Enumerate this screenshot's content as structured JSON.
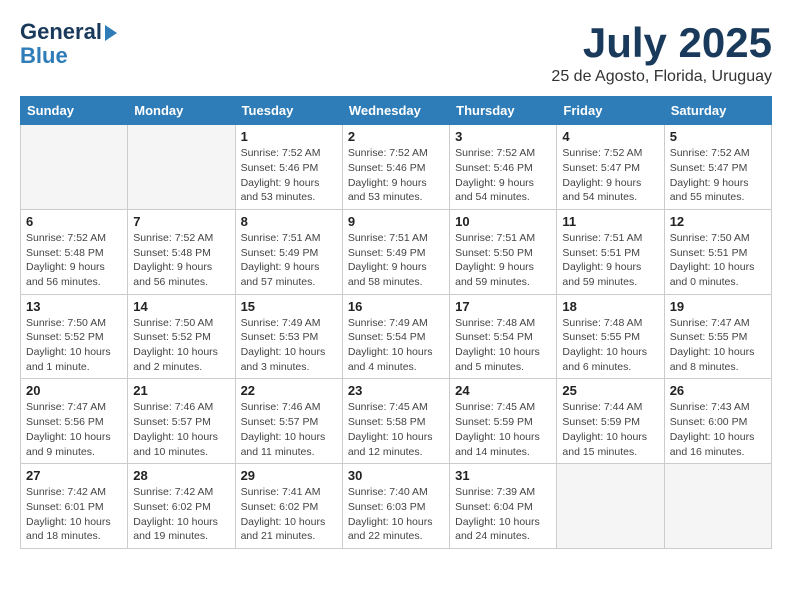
{
  "logo": {
    "line1": "General",
    "line2": "Blue"
  },
  "title": "July 2025",
  "location": "25 de Agosto, Florida, Uruguay",
  "days_of_week": [
    "Sunday",
    "Monday",
    "Tuesday",
    "Wednesday",
    "Thursday",
    "Friday",
    "Saturday"
  ],
  "weeks": [
    [
      {
        "day": "",
        "info": ""
      },
      {
        "day": "",
        "info": ""
      },
      {
        "day": "1",
        "info": "Sunrise: 7:52 AM\nSunset: 5:46 PM\nDaylight: 9 hours\nand 53 minutes."
      },
      {
        "day": "2",
        "info": "Sunrise: 7:52 AM\nSunset: 5:46 PM\nDaylight: 9 hours\nand 53 minutes."
      },
      {
        "day": "3",
        "info": "Sunrise: 7:52 AM\nSunset: 5:46 PM\nDaylight: 9 hours\nand 54 minutes."
      },
      {
        "day": "4",
        "info": "Sunrise: 7:52 AM\nSunset: 5:47 PM\nDaylight: 9 hours\nand 54 minutes."
      },
      {
        "day": "5",
        "info": "Sunrise: 7:52 AM\nSunset: 5:47 PM\nDaylight: 9 hours\nand 55 minutes."
      }
    ],
    [
      {
        "day": "6",
        "info": "Sunrise: 7:52 AM\nSunset: 5:48 PM\nDaylight: 9 hours\nand 56 minutes."
      },
      {
        "day": "7",
        "info": "Sunrise: 7:52 AM\nSunset: 5:48 PM\nDaylight: 9 hours\nand 56 minutes."
      },
      {
        "day": "8",
        "info": "Sunrise: 7:51 AM\nSunset: 5:49 PM\nDaylight: 9 hours\nand 57 minutes."
      },
      {
        "day": "9",
        "info": "Sunrise: 7:51 AM\nSunset: 5:49 PM\nDaylight: 9 hours\nand 58 minutes."
      },
      {
        "day": "10",
        "info": "Sunrise: 7:51 AM\nSunset: 5:50 PM\nDaylight: 9 hours\nand 59 minutes."
      },
      {
        "day": "11",
        "info": "Sunrise: 7:51 AM\nSunset: 5:51 PM\nDaylight: 9 hours\nand 59 minutes."
      },
      {
        "day": "12",
        "info": "Sunrise: 7:50 AM\nSunset: 5:51 PM\nDaylight: 10 hours\nand 0 minutes."
      }
    ],
    [
      {
        "day": "13",
        "info": "Sunrise: 7:50 AM\nSunset: 5:52 PM\nDaylight: 10 hours\nand 1 minute."
      },
      {
        "day": "14",
        "info": "Sunrise: 7:50 AM\nSunset: 5:52 PM\nDaylight: 10 hours\nand 2 minutes."
      },
      {
        "day": "15",
        "info": "Sunrise: 7:49 AM\nSunset: 5:53 PM\nDaylight: 10 hours\nand 3 minutes."
      },
      {
        "day": "16",
        "info": "Sunrise: 7:49 AM\nSunset: 5:54 PM\nDaylight: 10 hours\nand 4 minutes."
      },
      {
        "day": "17",
        "info": "Sunrise: 7:48 AM\nSunset: 5:54 PM\nDaylight: 10 hours\nand 5 minutes."
      },
      {
        "day": "18",
        "info": "Sunrise: 7:48 AM\nSunset: 5:55 PM\nDaylight: 10 hours\nand 6 minutes."
      },
      {
        "day": "19",
        "info": "Sunrise: 7:47 AM\nSunset: 5:55 PM\nDaylight: 10 hours\nand 8 minutes."
      }
    ],
    [
      {
        "day": "20",
        "info": "Sunrise: 7:47 AM\nSunset: 5:56 PM\nDaylight: 10 hours\nand 9 minutes."
      },
      {
        "day": "21",
        "info": "Sunrise: 7:46 AM\nSunset: 5:57 PM\nDaylight: 10 hours\nand 10 minutes."
      },
      {
        "day": "22",
        "info": "Sunrise: 7:46 AM\nSunset: 5:57 PM\nDaylight: 10 hours\nand 11 minutes."
      },
      {
        "day": "23",
        "info": "Sunrise: 7:45 AM\nSunset: 5:58 PM\nDaylight: 10 hours\nand 12 minutes."
      },
      {
        "day": "24",
        "info": "Sunrise: 7:45 AM\nSunset: 5:59 PM\nDaylight: 10 hours\nand 14 minutes."
      },
      {
        "day": "25",
        "info": "Sunrise: 7:44 AM\nSunset: 5:59 PM\nDaylight: 10 hours\nand 15 minutes."
      },
      {
        "day": "26",
        "info": "Sunrise: 7:43 AM\nSunset: 6:00 PM\nDaylight: 10 hours\nand 16 minutes."
      }
    ],
    [
      {
        "day": "27",
        "info": "Sunrise: 7:42 AM\nSunset: 6:01 PM\nDaylight: 10 hours\nand 18 minutes."
      },
      {
        "day": "28",
        "info": "Sunrise: 7:42 AM\nSunset: 6:02 PM\nDaylight: 10 hours\nand 19 minutes."
      },
      {
        "day": "29",
        "info": "Sunrise: 7:41 AM\nSunset: 6:02 PM\nDaylight: 10 hours\nand 21 minutes."
      },
      {
        "day": "30",
        "info": "Sunrise: 7:40 AM\nSunset: 6:03 PM\nDaylight: 10 hours\nand 22 minutes."
      },
      {
        "day": "31",
        "info": "Sunrise: 7:39 AM\nSunset: 6:04 PM\nDaylight: 10 hours\nand 24 minutes."
      },
      {
        "day": "",
        "info": ""
      },
      {
        "day": "",
        "info": ""
      }
    ]
  ]
}
